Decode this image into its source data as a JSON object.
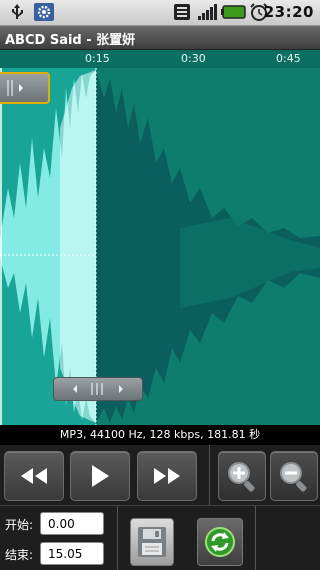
{
  "status_bar": {
    "time": "23:20",
    "icons": [
      "usb-icon",
      "settings-notification-icon",
      "wifi-icon",
      "signal-icon",
      "battery-icon",
      "alarm-icon"
    ]
  },
  "app": {
    "title": "ABCD Said - 张置妍"
  },
  "waveform": {
    "timeline_ticks": [
      "0:15",
      "0:30",
      "0:45"
    ],
    "colors": {
      "background": "#0e7d70",
      "selected_wave": "#7ff0ea",
      "unselected_wave": "#0a5c5c"
    }
  },
  "file_info": "MP3, 44100 Hz, 128 kbps, 181.81 秒",
  "controls": {
    "icons": [
      "rewind-icon",
      "play-icon",
      "fast-forward-icon",
      "zoom-in-icon",
      "zoom-out-icon"
    ]
  },
  "range": {
    "start_label": "开始:",
    "start_value": "0.00",
    "end_label": "结束:",
    "end_value": "15.05"
  },
  "actions": {
    "icons": [
      "save-icon",
      "reload-icon"
    ]
  }
}
